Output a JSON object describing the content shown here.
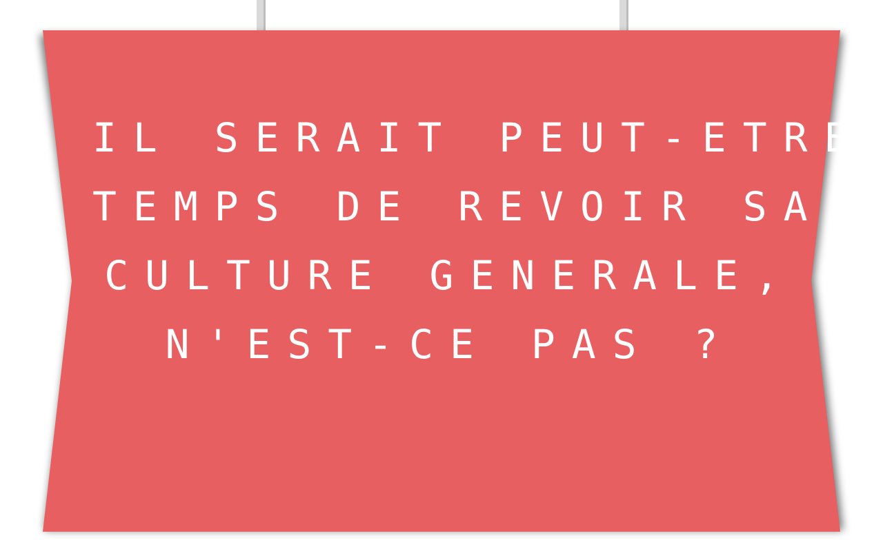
{
  "sign": {
    "color": "#e85f62",
    "string_color": "#d9d9d9",
    "lines": [
      "IL SERAIT PEUT-ETRE",
      "TEMPS DE REVOIR SA",
      "CULTURE GENERALE,",
      "N'EST-CE PAS ?"
    ]
  }
}
